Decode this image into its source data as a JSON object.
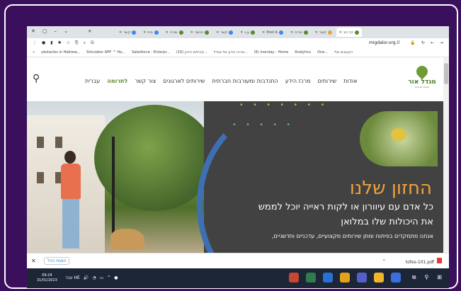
{
  "browser": {
    "tabs": [
      {
        "label": "קשר",
        "color": "#4285f4"
      },
      {
        "label": "בית",
        "color": "#4285f4"
      },
      {
        "label": "שירה",
        "color": "#5b8a2e"
      },
      {
        "label": "הכשר",
        "color": "#5b8a2e"
      },
      {
        "label": "קשר",
        "color": "#4285f4"
      },
      {
        "label": "ע.ג",
        "color": "#5b8a2e"
      },
      {
        "label": "Post A",
        "color": "#4285f4"
      },
      {
        "label": "מרכז",
        "color": "#5b8a2e"
      },
      {
        "label": "קשר",
        "color": "#e8a33a"
      },
      {
        "label": "דף הב",
        "color": "#5b8a2e",
        "active": true
      }
    ],
    "address_url": "migdalor.org.il",
    "bookmarks": [
      "הקבצים שלי",
      "One...",
      "Analytics",
      "(6) monday - Home",
      "מרכז הידע של מגדל...",
      "(10) קהילות הידע...",
      "Salesforce - Enterpr...",
      "Simulator APP ™ Ha...",
      "ubstacles in Hebrew..."
    ]
  },
  "site": {
    "nav_items": [
      "עברית",
      "לתרומה",
      "צור קשר",
      "שירותים לארגונים",
      "התנדבות ומעורבות חברתית",
      "מרכז הידע",
      "שירותים",
      "אודות"
    ],
    "logo_name": "מגדל אור",
    "logo_sub": "עמותה לעיוורים",
    "hero_title": "החזון שלנו",
    "hero_line1": "כל אדם עם עיוורון או לקות ראייה יוכל לממש",
    "hero_line2": "את היכולות שלו במלואן",
    "hero_line3": "אנחנו מתמקדים בפיתוח ומתן שירותים מקצועיים, עדכניים וחדשניים,"
  },
  "downloads": {
    "show_all": "הצגת הכל",
    "file_name": "tofes-101.pdf"
  },
  "taskbar": {
    "time": "09:24",
    "date": "31/01/2023",
    "lang": "עבר HE"
  }
}
